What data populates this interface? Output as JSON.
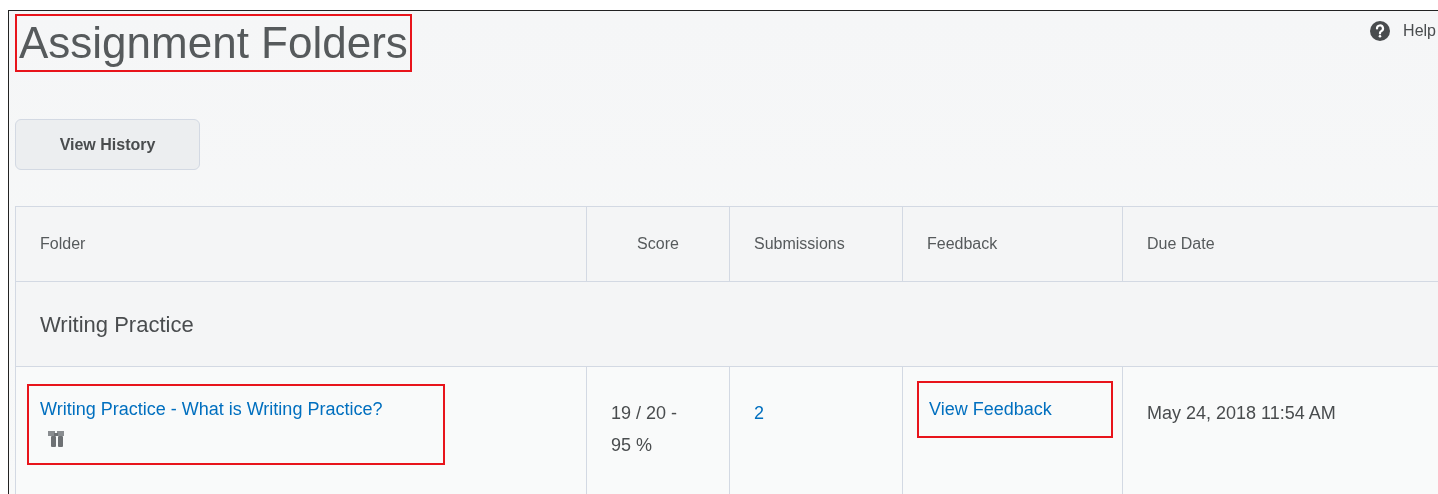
{
  "page": {
    "title": "Assignment Folders",
    "title_highlighted": true,
    "help": "Help"
  },
  "toolbar": {
    "buttons": [
      "View History"
    ]
  },
  "table": {
    "columns": [
      "Folder",
      "Score",
      "Submissions",
      "Feedback",
      "Due Date"
    ],
    "groups": [
      {
        "title": "Writing Practice",
        "rows": [
          {
            "folder": "Writing Practice - What is Writing Practice?",
            "folder_highlighted": true,
            "score": "19 / 20 - 95 %",
            "submissions": "2",
            "feedback": "View Feedback",
            "feedback_highlighted": true,
            "due_date": "May 24, 2018 11:54 AM"
          }
        ]
      }
    ]
  }
}
